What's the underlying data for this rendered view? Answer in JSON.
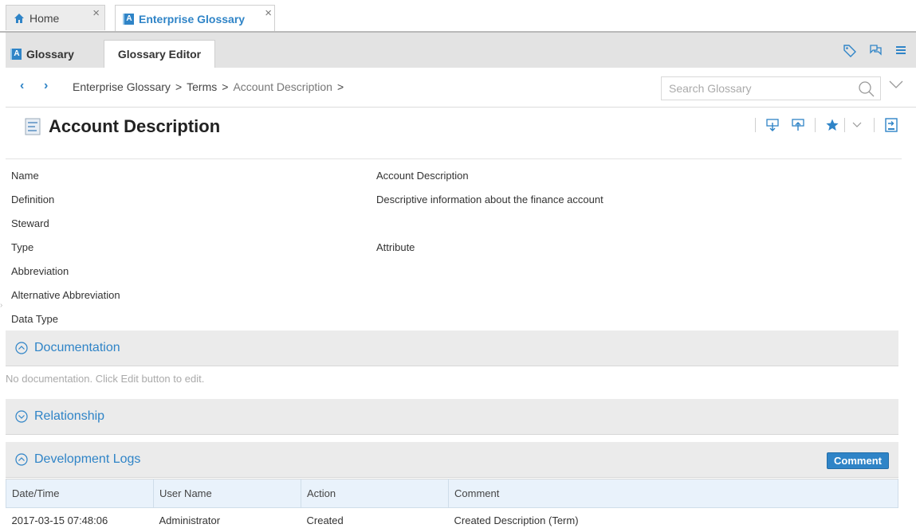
{
  "top_tabs": [
    {
      "label": "Home"
    },
    {
      "label": "Enterprise Glossary"
    }
  ],
  "glossary_tabs": {
    "glossary": "Glossary",
    "editor": "Glossary Editor"
  },
  "nav": {
    "breadcrumb": [
      "Enterprise Glossary",
      "Terms",
      "Account Description"
    ],
    "separator": ">",
    "search_placeholder": "Search Glossary"
  },
  "title": "Account Description",
  "properties": [
    {
      "key": "Name",
      "value": "Account Description"
    },
    {
      "key": "Definition",
      "value": "Descriptive information about the finance account"
    },
    {
      "key": "Steward",
      "value": ""
    },
    {
      "key": "Type",
      "value": "Attribute"
    },
    {
      "key": "Abbreviation",
      "value": ""
    },
    {
      "key": "Alternative Abbreviation",
      "value": ""
    },
    {
      "key": "Data Type",
      "value": ""
    }
  ],
  "sections": {
    "documentation": {
      "title": "Documentation",
      "empty_text": "No documentation. Click Edit button to edit."
    },
    "relationship": {
      "title": "Relationship"
    },
    "development_logs": {
      "title": "Development Logs",
      "comment_button": "Comment"
    }
  },
  "log_table": {
    "headers": [
      "Date/Time",
      "User Name",
      "Action",
      "Comment"
    ],
    "rows": [
      [
        "2017-03-15 07:48:06",
        "Administrator",
        "Created",
        "Created Description (Term)"
      ]
    ]
  },
  "colors": {
    "accent": "#2f84c7",
    "section_bg": "#ebebeb",
    "table_header_bg": "#e9f2fb"
  },
  "icons": [
    "home-icon",
    "glossary-icon",
    "tag-icon",
    "chat-icon",
    "menu-icon",
    "search-icon",
    "document-icon",
    "export-icon",
    "import-icon",
    "star-icon",
    "present-icon"
  ]
}
